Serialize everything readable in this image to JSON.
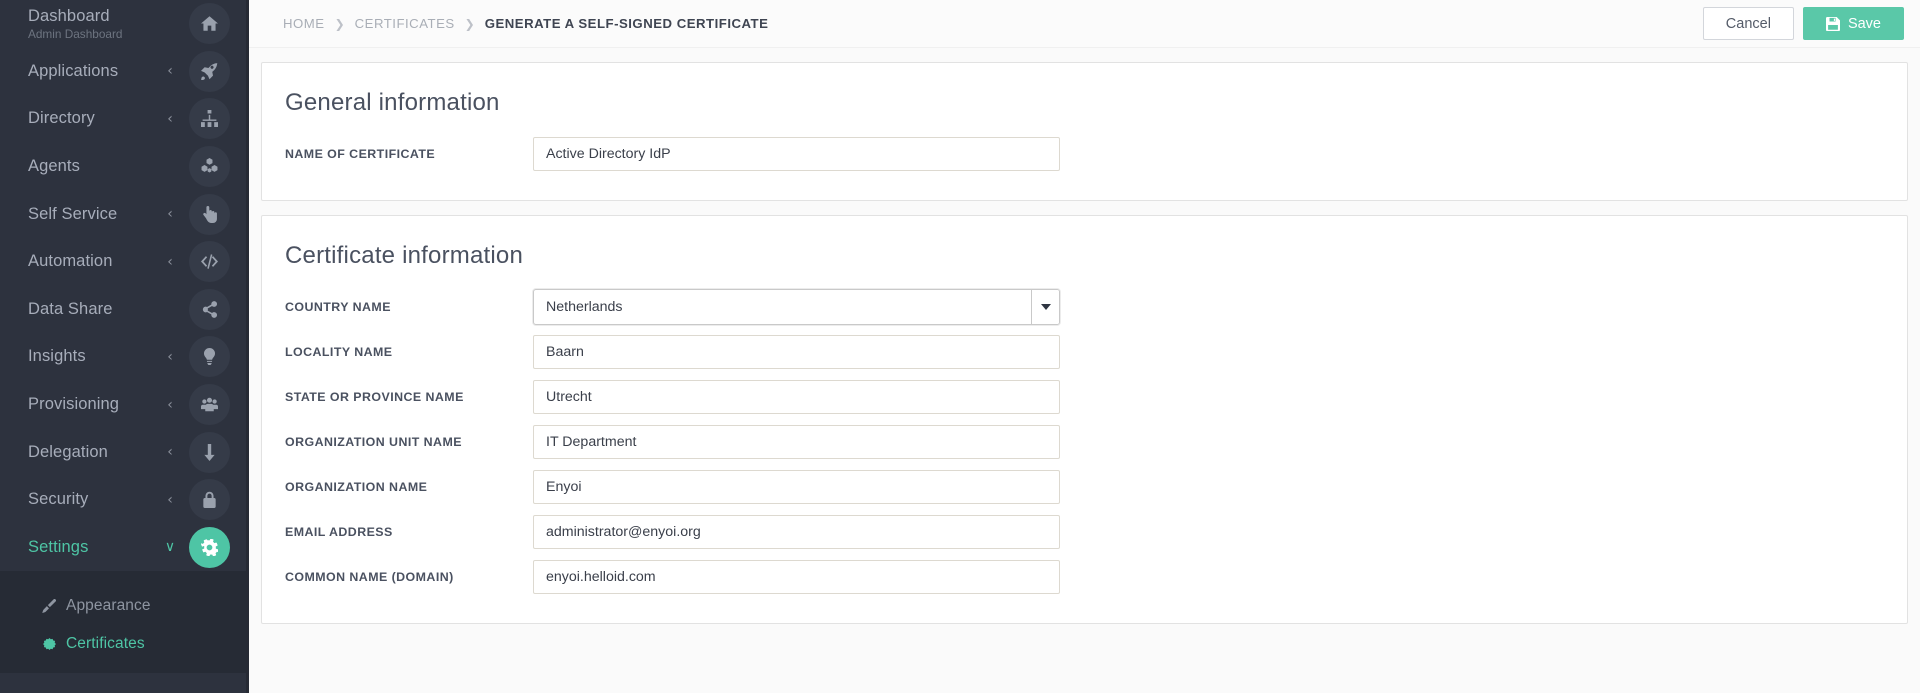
{
  "sidebar": {
    "items": [
      {
        "label": "Dashboard",
        "sublabel": "Admin Dashboard",
        "icon": "home-icon",
        "chevron": "",
        "active": false
      },
      {
        "label": "Applications",
        "sublabel": "",
        "icon": "rocket-icon",
        "chevron": "‹",
        "active": false
      },
      {
        "label": "Directory",
        "sublabel": "",
        "icon": "sitemap-icon",
        "chevron": "‹",
        "active": false
      },
      {
        "label": "Agents",
        "sublabel": "",
        "icon": "cubes-icon",
        "chevron": "",
        "active": false
      },
      {
        "label": "Self Service",
        "sublabel": "",
        "icon": "hand-pointer-icon",
        "chevron": "‹",
        "active": false
      },
      {
        "label": "Automation",
        "sublabel": "",
        "icon": "code-icon",
        "chevron": "‹",
        "active": false
      },
      {
        "label": "Data Share",
        "sublabel": "",
        "icon": "share-icon",
        "chevron": "",
        "active": false
      },
      {
        "label": "Insights",
        "sublabel": "",
        "icon": "lightbulb-icon",
        "chevron": "‹",
        "active": false
      },
      {
        "label": "Provisioning",
        "sublabel": "",
        "icon": "users-icon",
        "chevron": "‹",
        "active": false
      },
      {
        "label": "Delegation",
        "sublabel": "",
        "icon": "level-down-icon",
        "chevron": "‹",
        "active": false
      },
      {
        "label": "Security",
        "sublabel": "",
        "icon": "lock-icon",
        "chevron": "‹",
        "active": false
      },
      {
        "label": "Settings",
        "sublabel": "",
        "icon": "gear-icon",
        "chevron": "∨",
        "active": true
      }
    ],
    "submenu": [
      {
        "label": "Appearance",
        "icon": "paintbrush-icon",
        "active": false
      },
      {
        "label": "Certificates",
        "icon": "certificate-icon",
        "active": true
      }
    ]
  },
  "topbar": {
    "breadcrumb": [
      {
        "label": "HOME",
        "current": false
      },
      {
        "label": "CERTIFICATES",
        "current": false
      },
      {
        "label": "GENERATE A SELF-SIGNED CERTIFICATE",
        "current": true
      }
    ],
    "separator": "❯",
    "cancel_label": "Cancel",
    "save_label": "Save"
  },
  "general_panel": {
    "title": "General information",
    "fields": [
      {
        "label": "NAME OF CERTIFICATE",
        "value": "Active Directory IdP",
        "type": "text"
      }
    ]
  },
  "certificate_panel": {
    "title": "Certificate information",
    "fields": [
      {
        "label": "COUNTRY NAME",
        "value": "Netherlands",
        "type": "select"
      },
      {
        "label": "LOCALITY NAME",
        "value": "Baarn",
        "type": "text"
      },
      {
        "label": "STATE OR PROVINCE NAME",
        "value": "Utrecht",
        "type": "text"
      },
      {
        "label": "ORGANIZATION UNIT NAME",
        "value": "IT Department",
        "type": "text"
      },
      {
        "label": "ORGANIZATION NAME",
        "value": "Enyoi",
        "type": "text"
      },
      {
        "label": "EMAIL ADDRESS",
        "value": "administrator@enyoi.org",
        "type": "text"
      },
      {
        "label": "COMMON NAME (DOMAIN)",
        "value": "enyoi.helloid.com",
        "type": "text"
      }
    ]
  },
  "colors": {
    "accent": "#4ec5a5",
    "save_button": "#5ac8a8",
    "sidebar_bg": "#2d323e",
    "submenu_bg": "#262b35",
    "page_bg": "#fafafa"
  }
}
